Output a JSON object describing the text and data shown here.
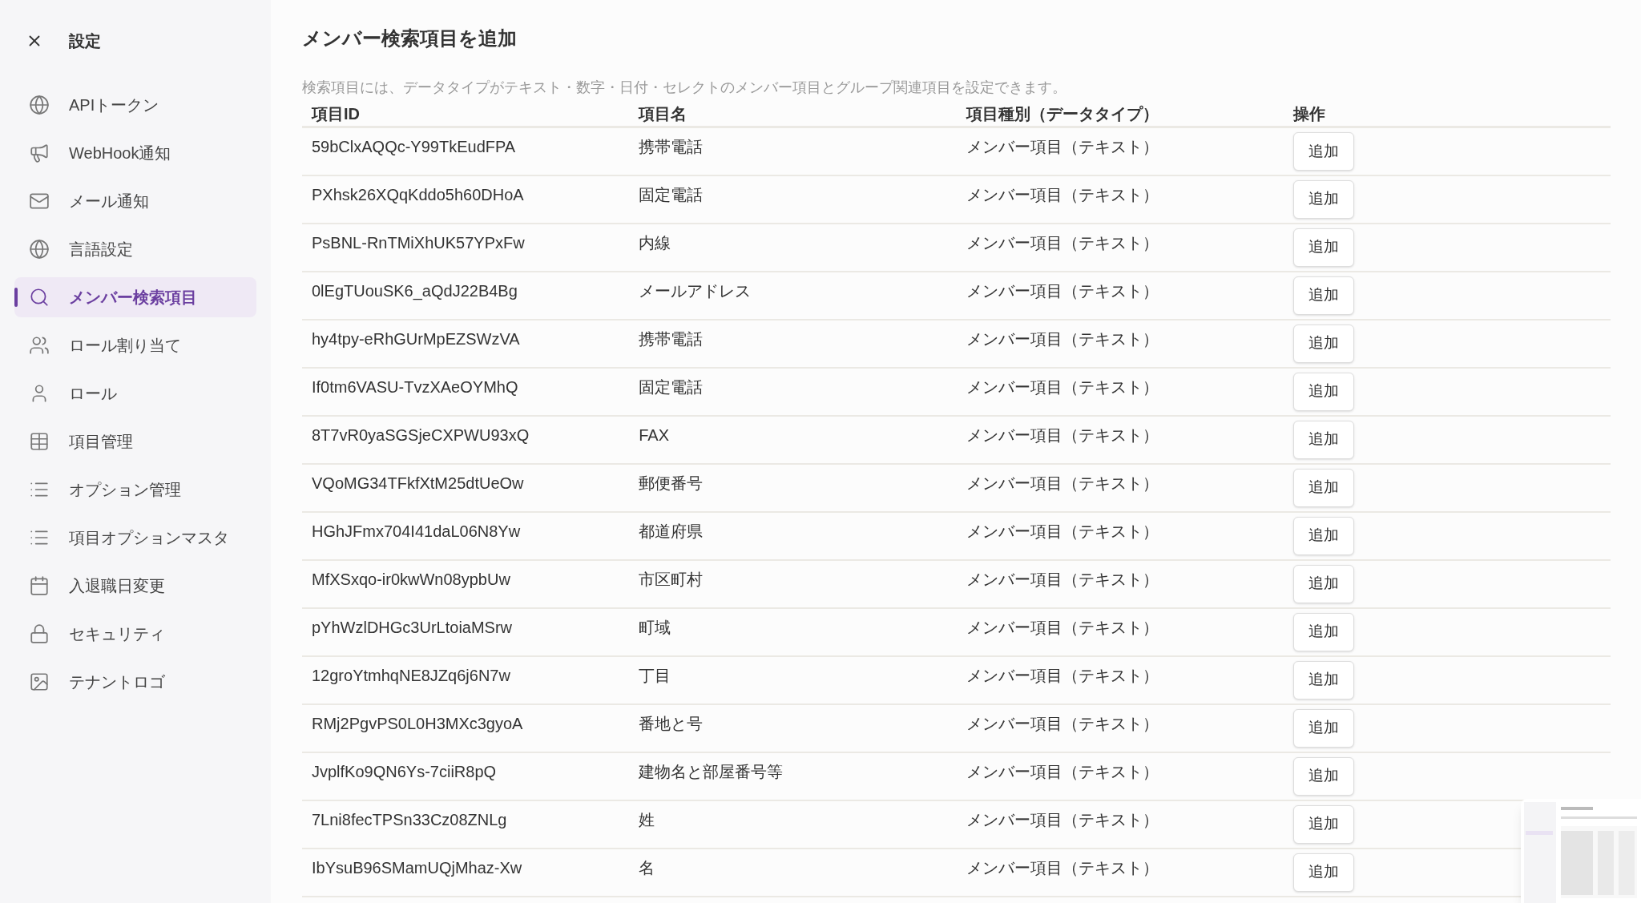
{
  "sidebar": {
    "title": "設定",
    "items": [
      {
        "label": "APIトークン",
        "selected": false
      },
      {
        "label": "WebHook通知",
        "selected": false
      },
      {
        "label": "メール通知",
        "selected": false
      },
      {
        "label": "言語設定",
        "selected": false
      },
      {
        "label": "メンバー検索項目",
        "selected": true
      },
      {
        "label": "ロール割り当て",
        "selected": false
      },
      {
        "label": "ロール",
        "selected": false
      },
      {
        "label": "項目管理",
        "selected": false
      },
      {
        "label": "オプション管理",
        "selected": false
      },
      {
        "label": "項目オプションマスタ",
        "selected": false
      },
      {
        "label": "入退職日変更",
        "selected": false
      },
      {
        "label": "セキュリティ",
        "selected": false
      },
      {
        "label": "テナントロゴ",
        "selected": false
      }
    ]
  },
  "page": {
    "title": "メンバー検索項目を追加",
    "description": "検索項目には、データタイプがテキスト・数字・日付・セレクトのメンバー項目とグループ関連項目を設定できます。"
  },
  "table": {
    "columns": [
      "項目ID",
      "項目名",
      "項目種別（データタイプ）",
      "操作"
    ],
    "rows": [
      {
        "id": "59bClxAQQc-Y99TkEudFPA",
        "name": "携帯電話",
        "type": "メンバー項目（テキスト）",
        "action": "追加"
      },
      {
        "id": "PXhsk26XQqKddo5h60DHoA",
        "name": "固定電話",
        "type": "メンバー項目（テキスト）",
        "action": "追加"
      },
      {
        "id": "PsBNL-RnTMiXhUK57YPxFw",
        "name": "内線",
        "type": "メンバー項目（テキスト）",
        "action": "追加"
      },
      {
        "id": "0lEgTUouSK6_aQdJ22B4Bg",
        "name": "メールアドレス",
        "type": "メンバー項目（テキスト）",
        "action": "追加"
      },
      {
        "id": "hy4tpy-eRhGUrMpEZSWzVA",
        "name": "携帯電話",
        "type": "メンバー項目（テキスト）",
        "action": "追加"
      },
      {
        "id": "If0tm6VASU-TvzXAeOYMhQ",
        "name": "固定電話",
        "type": "メンバー項目（テキスト）",
        "action": "追加"
      },
      {
        "id": "8T7vR0yaSGSjeCXPWU93xQ",
        "name": "FAX",
        "type": "メンバー項目（テキスト）",
        "action": "追加"
      },
      {
        "id": "VQoMG34TFkfXtM25dtUeOw",
        "name": "郵便番号",
        "type": "メンバー項目（テキスト）",
        "action": "追加"
      },
      {
        "id": "HGhJFmx704I41daL06N8Yw",
        "name": "都道府県",
        "type": "メンバー項目（テキスト）",
        "action": "追加"
      },
      {
        "id": "MfXSxqo-ir0kwWn08ypbUw",
        "name": "市区町村",
        "type": "メンバー項目（テキスト）",
        "action": "追加"
      },
      {
        "id": "pYhWzlDHGc3UrLtoiaMSrw",
        "name": "町域",
        "type": "メンバー項目（テキスト）",
        "action": "追加"
      },
      {
        "id": "12groYtmhqNE8JZq6j6N7w",
        "name": "丁目",
        "type": "メンバー項目（テキスト）",
        "action": "追加"
      },
      {
        "id": "RMj2PgvPS0L0H3MXc3gyoA",
        "name": "番地と号",
        "type": "メンバー項目（テキスト）",
        "action": "追加"
      },
      {
        "id": "JvplfKo9QN6Ys-7ciiR8pQ",
        "name": "建物名と部屋番号等",
        "type": "メンバー項目（テキスト）",
        "action": "追加"
      },
      {
        "id": "7Lni8fecTPSn33Cz08ZNLg",
        "name": "姓",
        "type": "メンバー項目（テキスト）",
        "action": "追加"
      },
      {
        "id": "IbYsuB96SMamUQjMhaz-Xw",
        "name": "名",
        "type": "メンバー項目（テキスト）",
        "action": "追加"
      }
    ]
  }
}
